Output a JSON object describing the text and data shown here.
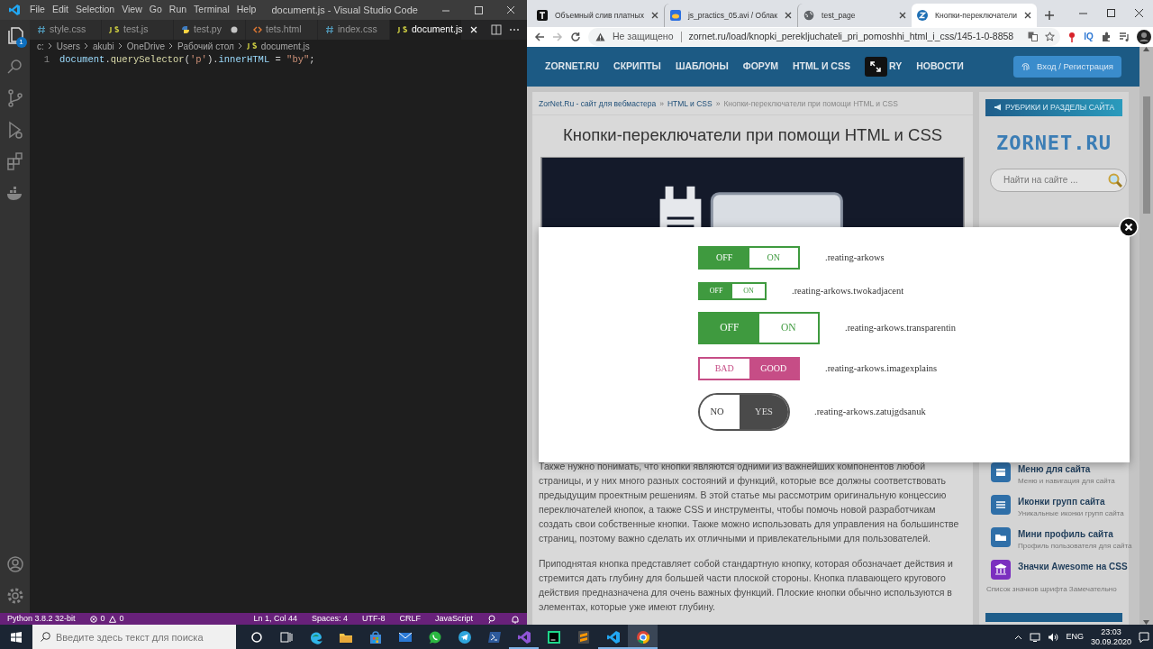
{
  "vscode": {
    "menu": [
      "File",
      "Edit",
      "Selection",
      "View",
      "Go",
      "Run",
      "Terminal",
      "Help"
    ],
    "title": "document.js - Visual Studio Code",
    "explorer_badge": "1",
    "tabs": [
      {
        "label": "style.css",
        "kind": "css",
        "selected": false,
        "modified": false
      },
      {
        "label": "test.js",
        "kind": "js",
        "selected": false,
        "modified": false
      },
      {
        "label": "test.py",
        "kind": "py",
        "selected": false,
        "modified": true
      },
      {
        "label": "tets.html",
        "kind": "html",
        "selected": false,
        "modified": false
      },
      {
        "label": "index.css",
        "kind": "css",
        "selected": false,
        "modified": false
      },
      {
        "label": "document.js",
        "kind": "js",
        "selected": true,
        "modified": false
      }
    ],
    "breadcrumbs": [
      {
        "label": "c:",
        "kind": "folder"
      },
      {
        "label": "Users",
        "kind": "folder"
      },
      {
        "label": "akubi",
        "kind": "folder"
      },
      {
        "label": "OneDrive",
        "kind": "folder"
      },
      {
        "label": "Рабочий стол",
        "kind": "folder"
      },
      {
        "label": "document.js",
        "kind": "js"
      }
    ],
    "code": [
      {
        "number": "1",
        "tokens": [
          {
            "text": "document",
            "kind": "var"
          },
          {
            "text": ".",
            "kind": "punct"
          },
          {
            "text": "querySelector",
            "kind": "func"
          },
          {
            "text": "(",
            "kind": "punct"
          },
          {
            "text": "'p'",
            "kind": "string"
          },
          {
            "text": ").",
            "kind": "punct"
          },
          {
            "text": "innerHTML",
            "kind": "var"
          },
          {
            "text": " = ",
            "kind": "punct"
          },
          {
            "text": "\"by\"",
            "kind": "string"
          },
          {
            "text": ";",
            "kind": "punct"
          }
        ]
      }
    ],
    "status_bar": {
      "interpreter": "Python 3.8.2 32-bit",
      "errors": "0",
      "warnings": "0",
      "position": "Ln 1, Col 44",
      "indent": "Spaces: 4",
      "encoding": "UTF-8",
      "eol": "CRLF",
      "language": "JavaScript"
    }
  },
  "browser": {
    "tabs": [
      {
        "label": "Объемный слив платных",
        "kind": "letter",
        "selected": false
      },
      {
        "label": "js_practics_05.avi / Облак",
        "kind": "cloud",
        "selected": false
      },
      {
        "label": "test_page",
        "kind": "globe",
        "selected": false
      },
      {
        "label": "Кнопки-переключатели",
        "kind": "site",
        "selected": true
      }
    ],
    "security": "Не защищено",
    "url": "zornet.ru/load/knopki_perekljuchateli_pri_pomoshhi_html_i_css/145-1-0-8858",
    "extension_label": "IQ",
    "page": {
      "nav": [
        {
          "label": "ZORNET.RU",
          "kind": "link"
        },
        {
          "label": "СКРИПТЫ",
          "kind": "link"
        },
        {
          "label": "ШАБЛОНЫ",
          "kind": "link"
        },
        {
          "label": "ФОРУМ",
          "kind": "link"
        },
        {
          "label": "HTML И CSS",
          "kind": "link"
        },
        {
          "label": "RY",
          "kind": "covered"
        },
        {
          "label": "НОВОСТИ",
          "kind": "link"
        }
      ],
      "login": "Вход / Регистрация",
      "breadcrumbs": [
        {
          "label": "ZorNet.Ru - сайт для вебмастера",
          "kind": "link"
        },
        {
          "label": "»",
          "kind": "separator"
        },
        {
          "label": "HTML и CSS",
          "kind": "link"
        },
        {
          "label": "»",
          "kind": "separator"
        },
        {
          "label": "Кнопки-переключатели при помощи HTML и CSS",
          "kind": "current"
        }
      ],
      "title": "Кнопки-переключатели при помощи HTML и CSS",
      "paragraphs": [
        "Также нужно понимать, что кнопки являются одними из важнейших компонентов любой страницы, и у них много разных состояний и функций, которые все должны соответствовать предыдущим проектным решениям. В этой статье мы рассмотрим оригинальную концессию переключателей кнопок, а также CSS и инструменты, чтобы помочь новой разработчикам создать свои собственные кнопки. Также можно использовать для управления на большинстве страниц, поэтому важно сделать их отличными и привлекательными для пользователей.",
        "Приподнятая кнопка представляет собой стандартную кнопку, которая обозначает действия и стремится дать глубину для большей части плоской стороны. Кнопка плавающего кругового действия предназначена для очень важных функций. Плоские кнопки обычно используются в элементах, которые уже имеют глубину."
      ],
      "sidebar": {
        "header": "РУБРИКИ И РАЗДЕЛЫ САЙТА",
        "logo": "ZORNET.RU",
        "search_placeholder": "Найти на сайте ...",
        "items": [
          {
            "title": "Меню для сайта",
            "subtitle": "Меню и навигация для сайта",
            "color": "#2f6fa8"
          },
          {
            "title": "Иконки групп сайта",
            "subtitle": "Уникальные иконки групп сайта",
            "color": "#2f6fa8"
          },
          {
            "title": "Мини профиль сайта",
            "subtitle": "Профиль пользователя для сайта",
            "color": "#2f6fa8"
          },
          {
            "title": "Значки Awesome на CSS",
            "color": "#7b2fbf"
          }
        ],
        "note": "Список значков шрифта Замечательно"
      },
      "modal": {
        "toggles": [
          {
            "kind": "medium",
            "color": "#3f9a3f",
            "left": {
              "label": "OFF",
              "selected": true
            },
            "right": {
              "label": "ON",
              "selected": false
            },
            "class_name": ".reating-arkows"
          },
          {
            "kind": "small",
            "color": "#3f9a3f",
            "left": {
              "label": "OFF",
              "selected": true
            },
            "right": {
              "label": "ON",
              "selected": false
            },
            "class_name": ".reating-arkows.twokadjacent"
          },
          {
            "kind": "large",
            "color": "#3f9a3f",
            "left": {
              "label": "OFF",
              "selected": true
            },
            "right": {
              "label": "ON",
              "selected": false
            },
            "class_name": ".reating-arkows.transparentin"
          },
          {
            "kind": "medium",
            "color": "#c64d86",
            "left": {
              "label": "BAD",
              "selected": false
            },
            "right": {
              "label": "GOOD",
              "selected": true
            },
            "class_name": ".reating-arkows.imagexplains"
          },
          {
            "kind": "pill",
            "color": "#4a4a4a",
            "left": {
              "label": "NO",
              "selected": false
            },
            "right": {
              "label": "YES",
              "selected": true
            },
            "class_name": ".reating-arkows.zatujgdsanuk"
          }
        ]
      }
    }
  },
  "taskbar": {
    "search_placeholder": "Введите здесь текст для поиска",
    "apps": [
      {
        "kind": "cortana",
        "running": false,
        "selected": false
      },
      {
        "kind": "taskview",
        "running": false,
        "selected": false
      },
      {
        "kind": "edge",
        "running": false,
        "selected": false
      },
      {
        "kind": "explorer",
        "running": false,
        "selected": false
      },
      {
        "kind": "store",
        "running": false,
        "selected": false
      },
      {
        "kind": "mail",
        "running": false,
        "selected": false
      },
      {
        "kind": "whatsapp",
        "running": false,
        "selected": false
      },
      {
        "kind": "telegram",
        "running": false,
        "selected": false
      },
      {
        "kind": "powershell",
        "running": false,
        "selected": false
      },
      {
        "kind": "vs",
        "running": true,
        "selected": false
      },
      {
        "kind": "pycharm",
        "running": false,
        "selected": false
      },
      {
        "kind": "sublime",
        "running": false,
        "selected": false
      },
      {
        "kind": "vscode",
        "running": true,
        "selected": false
      },
      {
        "kind": "chrome",
        "running": true,
        "selected": true
      }
    ],
    "language": "ENG",
    "time": "23:03",
    "date": "30.09.2020"
  }
}
